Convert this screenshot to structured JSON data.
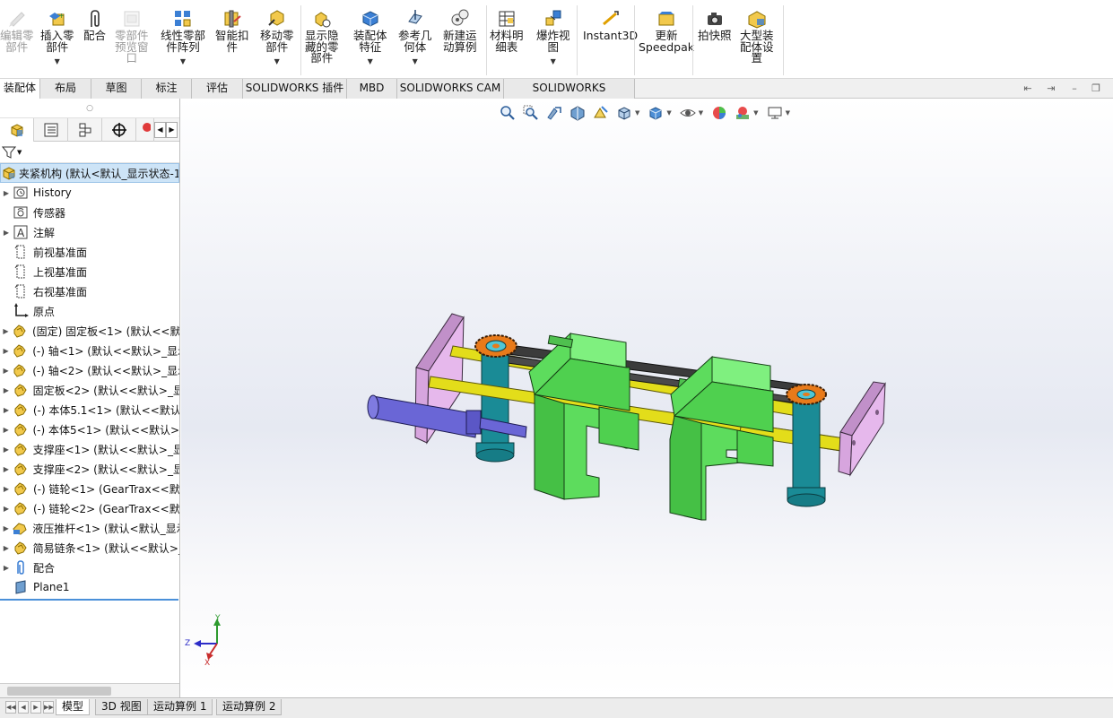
{
  "ribbon": {
    "buttons": [
      {
        "id": "edit-component",
        "label": "编辑零\n部件",
        "icon": "edit-component-icon",
        "disabled": true,
        "dropdown": false
      },
      {
        "id": "insert-component",
        "label": "插入零\n部件",
        "icon": "insert-component-icon",
        "disabled": false,
        "dropdown": true
      },
      {
        "id": "mate",
        "label": "配合",
        "icon": "mate-paperclip-icon",
        "disabled": false,
        "dropdown": false
      },
      {
        "id": "component-preview",
        "label": "零部件\n预览窗\n口",
        "icon": "preview-window-icon",
        "disabled": true,
        "dropdown": false
      },
      {
        "id": "linear-pattern",
        "label": "线性零部\n件阵列",
        "icon": "linear-pattern-icon",
        "disabled": false,
        "dropdown": true
      },
      {
        "id": "smart-fasteners",
        "label": "智能扣\n件",
        "icon": "smart-fasteners-icon",
        "disabled": false,
        "dropdown": false
      },
      {
        "id": "move-component",
        "label": "移动零\n部件",
        "icon": "move-component-icon",
        "disabled": false,
        "dropdown": true
      },
      {
        "id": "show-hidden",
        "label": "显示隐\n藏的零\n部件",
        "icon": "show-hidden-icon",
        "disabled": false,
        "dropdown": false
      },
      {
        "id": "assembly-features",
        "label": "装配体\n特征",
        "icon": "assembly-features-icon",
        "disabled": false,
        "dropdown": true
      },
      {
        "id": "reference-geometry",
        "label": "参考几\n何体",
        "icon": "reference-geometry-icon",
        "disabled": false,
        "dropdown": true
      },
      {
        "id": "new-motion-study",
        "label": "新建运\n动算例",
        "icon": "motion-study-icon",
        "disabled": false,
        "dropdown": false
      },
      {
        "id": "bom",
        "label": "材料明\n细表",
        "icon": "bill-of-materials-icon",
        "disabled": false,
        "dropdown": false
      },
      {
        "id": "exploded-view",
        "label": "爆炸视\n图",
        "icon": "exploded-view-icon",
        "disabled": false,
        "dropdown": true
      },
      {
        "id": "instant3d",
        "label": "Instant3D",
        "icon": "instant3d-icon",
        "disabled": false,
        "dropdown": false
      },
      {
        "id": "update-speedpak",
        "label": "更新\nSpeedpak",
        "icon": "speedpak-icon",
        "disabled": false,
        "dropdown": false
      },
      {
        "id": "snapshot",
        "label": "拍快照",
        "icon": "camera-icon",
        "disabled": false,
        "dropdown": false
      },
      {
        "id": "large-assembly",
        "label": "大型装\n配体设\n置",
        "icon": "large-assembly-icon",
        "disabled": false,
        "dropdown": false
      }
    ]
  },
  "tabs": [
    "装配体",
    "布局",
    "草图",
    "标注",
    "评估",
    "SOLIDWORKS 插件",
    "MBD",
    "SOLIDWORKS CAM",
    "SOLIDWORKS Inspection"
  ],
  "active_tab": "装配体",
  "feature_tree": {
    "root": "夹紧机构 (默认<默认_显示状态-1",
    "items": [
      {
        "label": "History",
        "icon": "history-folder-icon",
        "expandable": true
      },
      {
        "label": "传感器",
        "icon": "sensors-icon",
        "expandable": false
      },
      {
        "label": "注解",
        "icon": "annotations-icon",
        "expandable": true
      },
      {
        "label": "前视基准面",
        "icon": "plane-icon",
        "expandable": false
      },
      {
        "label": "上视基准面",
        "icon": "plane-icon",
        "expandable": false
      },
      {
        "label": "右视基准面",
        "icon": "plane-icon",
        "expandable": false
      },
      {
        "label": "原点",
        "icon": "origin-icon",
        "expandable": false
      },
      {
        "label": "(固定) 固定板<1> (默认<<默认",
        "icon": "part-icon",
        "expandable": true
      },
      {
        "label": "(-) 轴<1> (默认<<默认>_显示",
        "icon": "part-icon",
        "expandable": true
      },
      {
        "label": "(-) 轴<2> (默认<<默认>_显示",
        "icon": "part-icon",
        "expandable": true
      },
      {
        "label": "固定板<2> (默认<<默认>_显",
        "icon": "part-icon",
        "expandable": true
      },
      {
        "label": "(-) 本体5.1<1> (默认<<默认",
        "icon": "part-icon",
        "expandable": true
      },
      {
        "label": "(-) 本体5<1> (默认<<默认>_",
        "icon": "part-icon",
        "expandable": true
      },
      {
        "label": "支撑座<1> (默认<<默认>_显",
        "icon": "part-icon",
        "expandable": true
      },
      {
        "label": "支撑座<2> (默认<<默认>_显",
        "icon": "part-icon",
        "expandable": true
      },
      {
        "label": "(-) 链轮<1> (GearTrax<<默",
        "icon": "part-icon",
        "expandable": true
      },
      {
        "label": "(-) 链轮<2> (GearTrax<<默",
        "icon": "part-icon",
        "expandable": true
      },
      {
        "label": "液压推杆<1> (默认<默认_显示",
        "icon": "subassembly-icon",
        "expandable": true
      },
      {
        "label": "简易链条<1> (默认<<默认>_",
        "icon": "part-icon",
        "expandable": true
      },
      {
        "label": "配合",
        "icon": "mates-folder-icon",
        "expandable": true
      },
      {
        "label": "Plane1",
        "icon": "plane1-icon",
        "expandable": false
      }
    ]
  },
  "bottom_tabs": [
    "模型",
    "3D 视图",
    "运动算例 1",
    "运动算例 2"
  ],
  "active_bottom_tab": "模型",
  "triad": {
    "y": "Y",
    "z": "Z",
    "x": "X"
  },
  "colors": {
    "frame_green": "#5ddc5d",
    "shaft_yellow": "#e3dd1a",
    "plate_pink": "#d7a5de",
    "column_teal": "#1a8b96",
    "sprocket_orange": "#e87a1a",
    "cylinder_blue": "#6a66d6",
    "selection_blue": "#cde4f7"
  }
}
